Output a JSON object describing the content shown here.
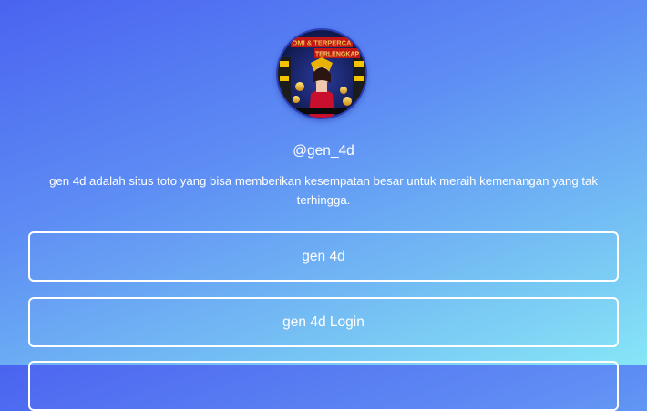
{
  "profile": {
    "username": "@gen_4d",
    "bio": "gen 4d adalah situs toto yang bisa memberikan kesempatan besar untuk meraih kemenangan yang tak terhingga.",
    "avatar_text_top": "OMI & TERPERCA",
    "avatar_text_mid": "TERLENGKAP"
  },
  "links": [
    {
      "label": "gen 4d"
    },
    {
      "label": "gen 4d Login"
    },
    {
      "label": ""
    }
  ],
  "colors": {
    "gradient_start": "#4a63f0",
    "gradient_end": "#86e6f6",
    "text": "#ffffff"
  }
}
